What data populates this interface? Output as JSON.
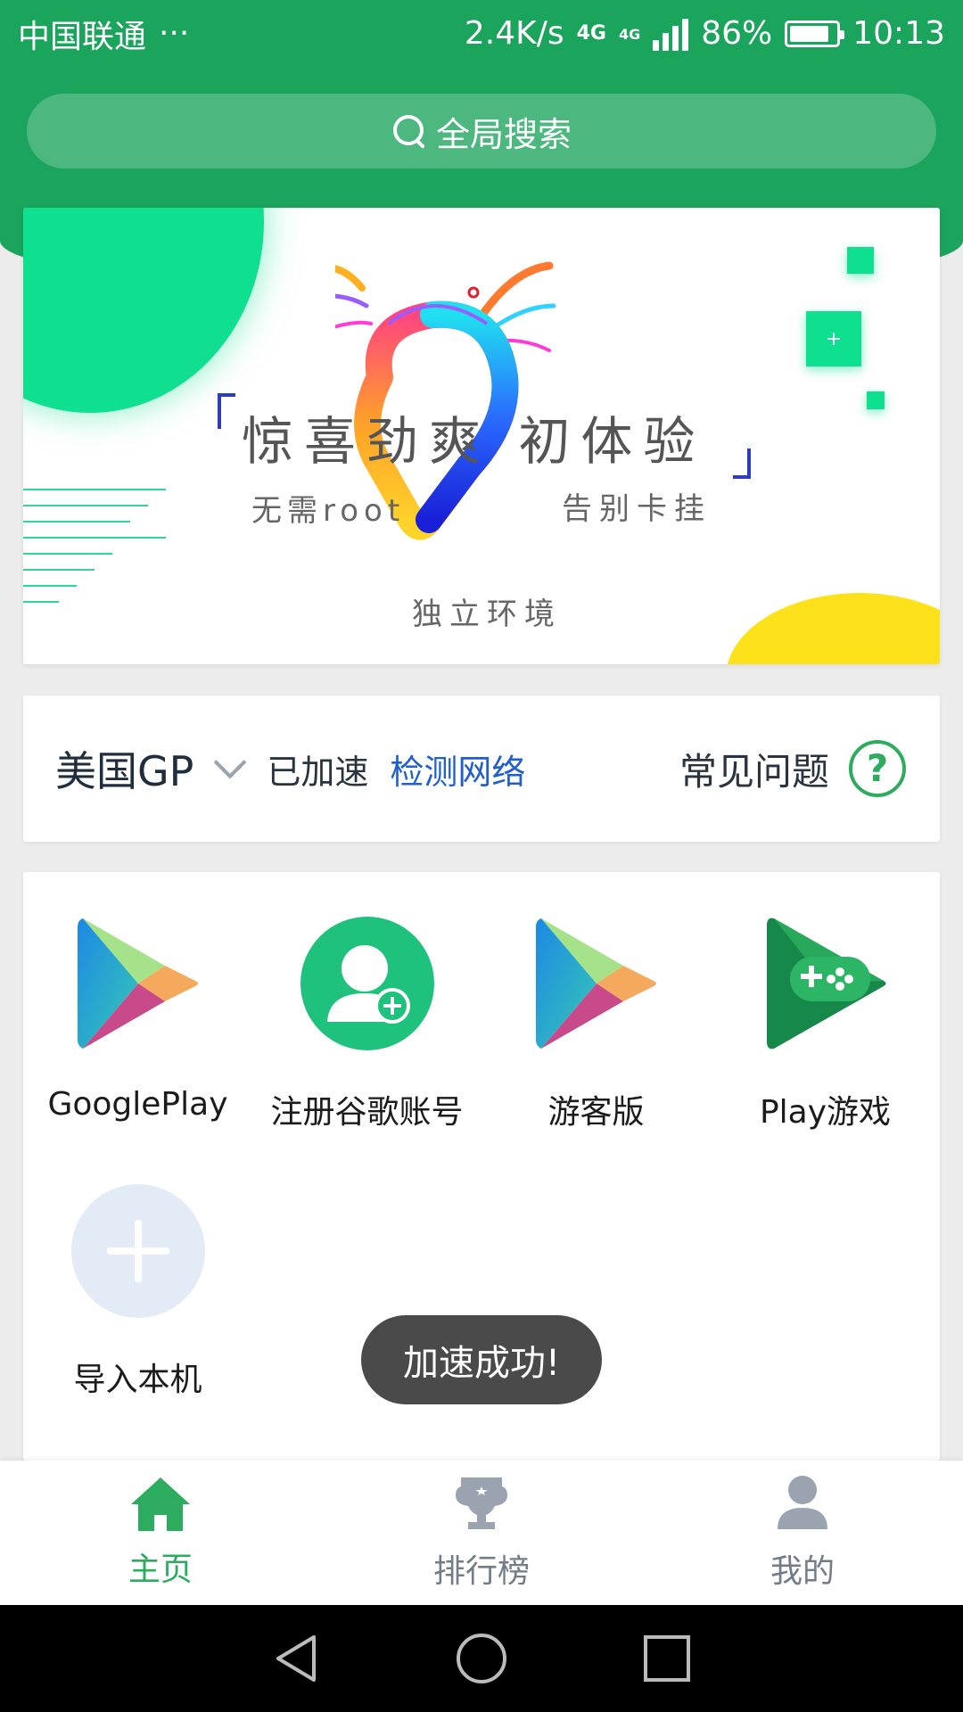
{
  "status_bar": {
    "carrier": "中国联通",
    "more": "···",
    "net_speed": "2.4K/s",
    "net_type_1": "4G",
    "net_type_2": "4G",
    "battery": "86%",
    "battery_level": 0.86,
    "time": "10:13"
  },
  "search": {
    "label": "全局搜索"
  },
  "banner": {
    "title": "惊喜劲爽  初体验",
    "sub_left": "无需root",
    "sub_right": "告别卡挂",
    "sub_bottom": "独立环境",
    "accent_green": "#0ee08f",
    "accent_yellow": "#fde21b"
  },
  "region": {
    "name": "美国GP",
    "status": "已加速",
    "detect": "检测网络",
    "faq": "常见问题"
  },
  "apps": [
    {
      "label": "GooglePlay",
      "icon": "google-play-icon"
    },
    {
      "label": "注册谷歌账号",
      "icon": "add-account-icon"
    },
    {
      "label": "游客版",
      "icon": "google-play-icon"
    },
    {
      "label": "Play游戏",
      "icon": "play-games-icon"
    },
    {
      "label": "导入本机",
      "icon": "plus-icon"
    }
  ],
  "toast": "加速成功!",
  "bottom_nav": {
    "items": [
      {
        "label": "主页",
        "icon": "home-icon",
        "active": true
      },
      {
        "label": "排行榜",
        "icon": "trophy-icon",
        "active": false
      },
      {
        "label": "我的",
        "icon": "person-icon",
        "active": false
      }
    ]
  },
  "colors": {
    "primary_green": "#1aa45c",
    "link_blue": "#1f5fcf",
    "active_tab": "#2dab5f",
    "inactive_tab": "#9aa4b0"
  }
}
